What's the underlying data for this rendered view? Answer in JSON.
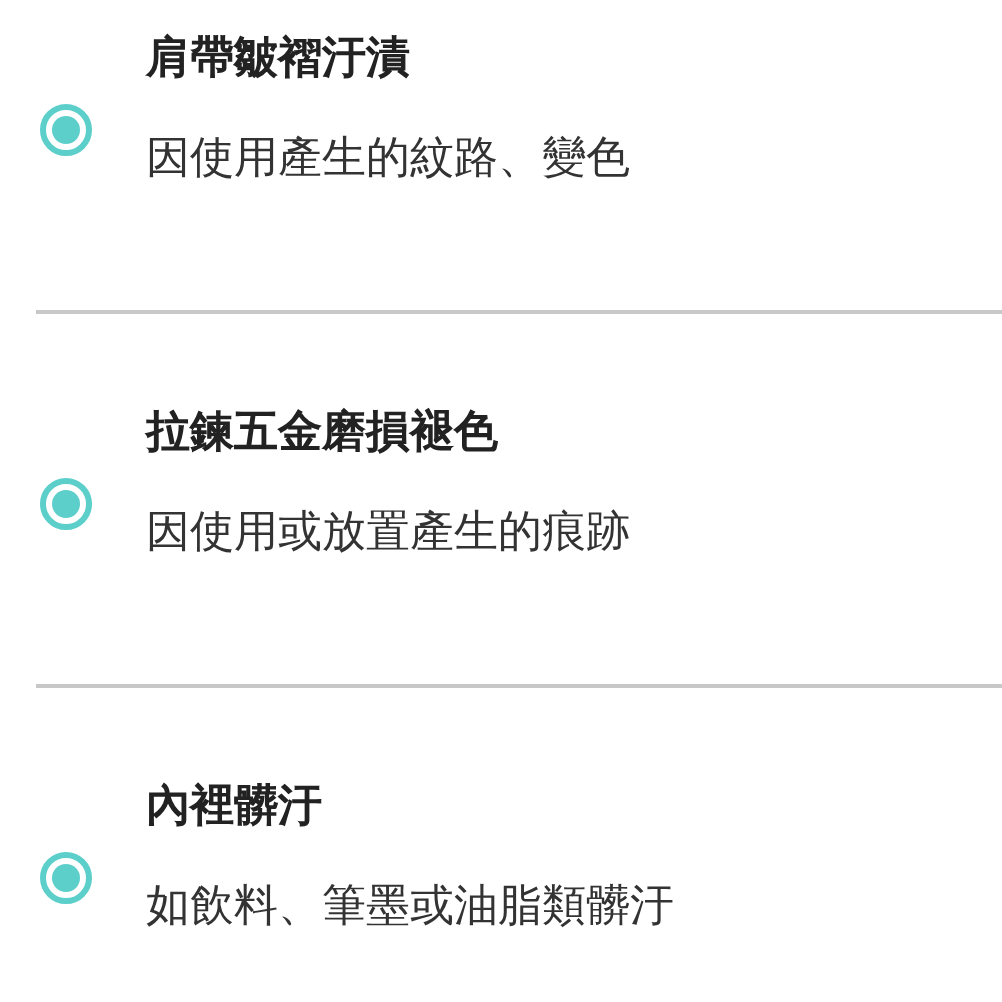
{
  "options": [
    {
      "title": "肩帶皺褶汙漬",
      "description": "因使用產生的紋路、變色",
      "selected": true
    },
    {
      "title": "拉鍊五金磨損褪色",
      "description": "因使用或放置產生的痕跡",
      "selected": true
    },
    {
      "title": "內裡髒汙",
      "description": "如飲料、筆墨或油脂類髒汙",
      "selected": true
    }
  ]
}
